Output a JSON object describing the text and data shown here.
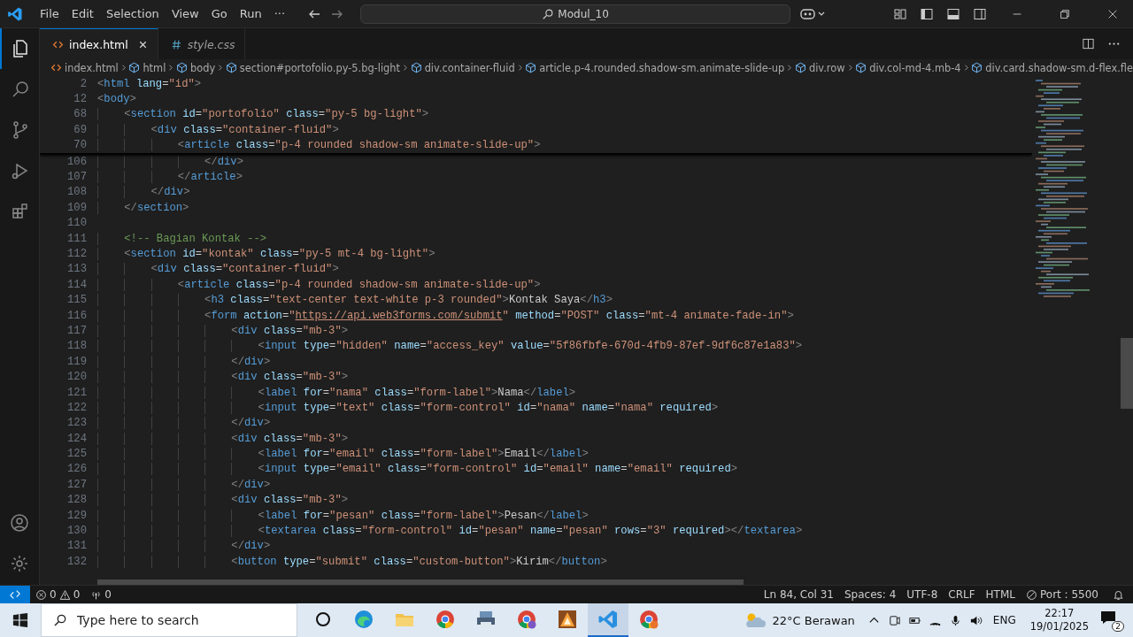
{
  "menu": [
    "File",
    "Edit",
    "Selection",
    "View",
    "Go",
    "Run",
    "···"
  ],
  "command_center": "Modul_10",
  "activity_bar": [
    {
      "kind": "explorer",
      "selected": true
    },
    {
      "kind": "search",
      "selected": false
    },
    {
      "kind": "source-control",
      "selected": false
    },
    {
      "kind": "run",
      "selected": false
    },
    {
      "kind": "extensions",
      "selected": false
    }
  ],
  "activity_bottom": [
    {
      "kind": "account"
    },
    {
      "kind": "settings"
    }
  ],
  "tabs": [
    {
      "label": "index.html",
      "kind": "html",
      "selected": true,
      "preview": false
    },
    {
      "label": "style.css",
      "kind": "css",
      "selected": false,
      "preview": true
    }
  ],
  "breadcrumb": [
    {
      "label": "index.html",
      "kind": "file"
    },
    {
      "label": "html",
      "kind": "element"
    },
    {
      "label": "body",
      "kind": "element"
    },
    {
      "label": "section#portofolio.py-5.bg-light",
      "kind": "element"
    },
    {
      "label": "div.container-fluid",
      "kind": "element"
    },
    {
      "label": "article.p-4.rounded.shadow-sm.animate-slide-up",
      "kind": "element"
    },
    {
      "label": "div.row",
      "kind": "element"
    },
    {
      "label": "div.col-md-4.mb-4",
      "kind": "element"
    },
    {
      "label": "div.card.shadow-sm.d-flex.fle",
      "kind": "element"
    }
  ],
  "sticky_lines": [
    {
      "number": "2",
      "text": "<html lang=\"id\">"
    },
    {
      "number": "12",
      "text": "<body>"
    },
    {
      "number": "68",
      "text": "    <section id=\"portofolio\" class=\"py-5 bg-light\">"
    },
    {
      "number": "69",
      "text": "        <div class=\"container-fluid\">"
    },
    {
      "number": "70",
      "text": "            <article class=\"p-4 rounded shadow-sm animate-slide-up\">"
    }
  ],
  "lines": [
    {
      "number": "106",
      "text": "                </div>"
    },
    {
      "number": "107",
      "text": "            </article>"
    },
    {
      "number": "108",
      "text": "        </div>"
    },
    {
      "number": "109",
      "text": "    </section>"
    },
    {
      "number": "110"
    },
    {
      "number": "111",
      "text": "    <!-- Bagian Kontak -->"
    },
    {
      "number": "112",
      "text": "    <section id=\"kontak\" class=\"py-5 mt-4 bg-light\">"
    },
    {
      "number": "113",
      "text": "        <div class=\"container-fluid\">"
    },
    {
      "number": "114",
      "text": "            <article class=\"p-4 rounded shadow-sm animate-slide-up\">"
    },
    {
      "number": "115",
      "text": "                <h3 class=\"text-center text-white p-3 rounded\">Kontak Saya</h3>"
    },
    {
      "number": "116",
      "text": "                <form action=\"https://api.web3forms.com/submit\" method=\"POST\" class=\"mt-4 animate-fade-in\">"
    },
    {
      "number": "117",
      "text": "                    <div class=\"mb-3\">"
    },
    {
      "number": "118",
      "text": "                        <input type=\"hidden\" name=\"access_key\" value=\"5f86fbfe-670d-4fb9-87ef-9df6c87e1a83\">"
    },
    {
      "number": "119",
      "text": "                    </div>"
    },
    {
      "number": "120",
      "text": "                    <div class=\"mb-3\">"
    },
    {
      "number": "121",
      "text": "                        <label for=\"nama\" class=\"form-label\">Nama</label>"
    },
    {
      "number": "122",
      "text": "                        <input type=\"text\" class=\"form-control\" id=\"nama\" name=\"nama\" required>"
    },
    {
      "number": "123",
      "text": "                    </div>"
    },
    {
      "number": "124",
      "text": "                    <div class=\"mb-3\">"
    },
    {
      "number": "125",
      "text": "                        <label for=\"email\" class=\"form-label\">Email</label>"
    },
    {
      "number": "126",
      "text": "                        <input type=\"email\" class=\"form-control\" id=\"email\" name=\"email\" required>"
    },
    {
      "number": "127",
      "text": "                    </div>"
    },
    {
      "number": "128",
      "text": "                    <div class=\"mb-3\">"
    },
    {
      "number": "129",
      "text": "                        <label for=\"pesan\" class=\"form-label\">Pesan</label>"
    },
    {
      "number": "130",
      "text": "                        <textarea class=\"form-control\" id=\"pesan\" name=\"pesan\" rows=\"3\" required></textarea>"
    },
    {
      "number": "131",
      "text": "                    </div>"
    },
    {
      "number": "132",
      "text": "                    <button type=\"submit\" class=\"custom-button\">Kirim</button>"
    }
  ],
  "status_bar": {
    "problems": [
      {
        "kind": "error",
        "count": "0"
      },
      {
        "kind": "warning",
        "count": "0"
      }
    ],
    "ports": "0",
    "items": [
      "Ln 84, Col 31",
      "Spaces: 4",
      "UTF-8",
      "CRLF",
      "HTML"
    ],
    "live_server": "Port : 5500"
  },
  "taskbar": {
    "search_placeholder": "Type here to search",
    "apps": [
      {
        "kind": "task-view",
        "selected": false
      },
      {
        "kind": "edge",
        "selected": false
      },
      {
        "kind": "folder",
        "selected": false
      },
      {
        "kind": "chrome",
        "selected": false
      },
      {
        "kind": "printer",
        "selected": false
      },
      {
        "kind": "chrome-profile",
        "selected": false
      },
      {
        "kind": "orange",
        "selected": false
      },
      {
        "kind": "code",
        "selected": true
      },
      {
        "kind": "chrome-profile-2",
        "selected": false
      }
    ],
    "weather": "22°C Berawan",
    "language": "ENG",
    "time": "22:17",
    "date": "19/01/2025",
    "notifications": "2"
  }
}
